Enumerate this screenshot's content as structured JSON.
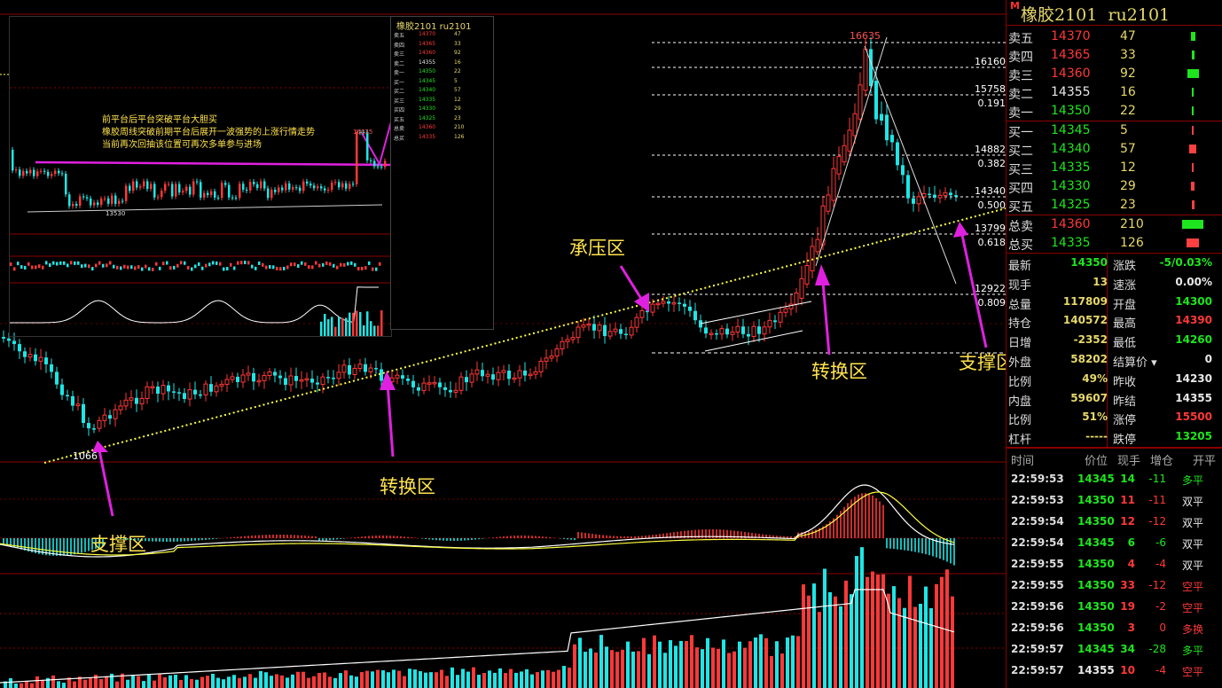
{
  "instrument": {
    "name": "橡胶2101",
    "code": "ru2101",
    "marker": "M"
  },
  "chart_annotations": {
    "support_left": "支撑区",
    "switch_mid": "转换区",
    "resist": "承压区",
    "switch_right": "转换区",
    "support_right": "支撑区",
    "low_label": "1066",
    "high_label": "16635",
    "note_lines": [
      "前平台后平台突破平台大胆买",
      "橡胶周线突破前期平台后展开一波强势的上涨行情走势",
      "当前再次回抽该位置可再次多单参与进场"
    ]
  },
  "fib_levels": [
    {
      "price": "16160",
      "ratio": ""
    },
    {
      "price": "15758",
      "ratio": "0.191"
    },
    {
      "price": "14882",
      "ratio": "0.382"
    },
    {
      "price": "14340",
      "ratio": "0.500"
    },
    {
      "price": "13799",
      "ratio": "0.618"
    },
    {
      "price": "12922",
      "ratio": "0.809"
    }
  ],
  "order_book": {
    "asks": [
      {
        "label": "卖五",
        "price": "14370",
        "vol": "47",
        "color": "#ff3838",
        "bar": 0.2
      },
      {
        "label": "卖四",
        "price": "14365",
        "vol": "33",
        "color": "#ff3838",
        "bar": 0.14
      },
      {
        "label": "卖三",
        "price": "14360",
        "vol": "92",
        "color": "#ff3838",
        "bar": 0.55
      },
      {
        "label": "卖二",
        "price": "14355",
        "vol": "16",
        "color": "#e8e8e8",
        "bar": 0.07
      },
      {
        "label": "卖一",
        "price": "14350",
        "vol": "22",
        "color": "#1ee61e",
        "bar": 0.09
      }
    ],
    "bids": [
      {
        "label": "买一",
        "price": "14345",
        "vol": "5",
        "color": "#1ee61e",
        "bar": 0.03
      },
      {
        "label": "买二",
        "price": "14340",
        "vol": "57",
        "color": "#1ee61e",
        "bar": 0.35
      },
      {
        "label": "买三",
        "price": "14335",
        "vol": "12",
        "color": "#1ee61e",
        "bar": 0.07
      },
      {
        "label": "买四",
        "price": "14330",
        "vol": "29",
        "color": "#1ee61e",
        "bar": 0.17
      },
      {
        "label": "买五",
        "price": "14325",
        "vol": "23",
        "color": "#1ee61e",
        "bar": 0.14
      }
    ],
    "total_ask": {
      "label": "总卖",
      "price": "14360",
      "vol": "210",
      "bar": 1.0
    },
    "total_bid": {
      "label": "总买",
      "price": "14335",
      "vol": "126",
      "bar": 0.6
    }
  },
  "quote": {
    "rows": [
      {
        "l1": "最新",
        "v1": "14350",
        "c1": "#1ee61e",
        "l2": "涨跌",
        "v2": "-5/0.03%",
        "c2": "#1ee61e"
      },
      {
        "l1": "现手",
        "v1": "13",
        "c1": "#e6d86a",
        "l2": "速涨",
        "v2": "0.00%",
        "c2": "#e8e8e8"
      },
      {
        "l1": "总量",
        "v1": "117809",
        "c1": "#e6d86a",
        "l2": "开盘",
        "v2": "14300",
        "c2": "#1ee61e"
      },
      {
        "l1": "持仓",
        "v1": "140572",
        "c1": "#e6d86a",
        "l2": "最高",
        "v2": "14390",
        "c2": "#ff3838"
      },
      {
        "l1": "日增",
        "v1": "-2352",
        "c1": "#e6d86a",
        "l2": "最低",
        "v2": "14260",
        "c2": "#1ee61e"
      },
      {
        "l1": "外盘",
        "v1": "58202",
        "c1": "#e6d86a",
        "l2": "结算价",
        "v2": "0",
        "c2": "#e8e8e8"
      },
      {
        "l1": "比例",
        "v1": "49%",
        "c1": "#e6d86a",
        "l2": "昨收",
        "v2": "14230",
        "c2": "#e8e8e8"
      },
      {
        "l1": "内盘",
        "v1": "59607",
        "c1": "#e6d86a",
        "l2": "昨结",
        "v2": "14355",
        "c2": "#e8e8e8"
      },
      {
        "l1": "比例",
        "v1": "51%",
        "c1": "#e6d86a",
        "l2": "涨停",
        "v2": "15500",
        "c2": "#ff3838"
      },
      {
        "l1": "杠杆",
        "v1": "-----",
        "c1": "#e6d86a",
        "l2": "跌停",
        "v2": "13205",
        "c2": "#1ee61e"
      }
    ]
  },
  "ticks": {
    "headers": [
      "时间",
      "价位",
      "现手",
      "增仓",
      "开平"
    ],
    "rows": [
      {
        "time": "22:59:53",
        "price": "14345",
        "pc": "#1ee61e",
        "vol": "14",
        "vc": "#1ee61e",
        "oi": "-11",
        "type": "多平",
        "tc": "#1ee61e"
      },
      {
        "time": "22:59:53",
        "price": "14350",
        "pc": "#1ee61e",
        "vol": "11",
        "vc": "#ff3838",
        "oi": "-11",
        "type": "双平",
        "tc": "#e8e8e8"
      },
      {
        "time": "22:59:54",
        "price": "14350",
        "pc": "#1ee61e",
        "vol": "12",
        "vc": "#ff3838",
        "oi": "-12",
        "type": "双平",
        "tc": "#e8e8e8"
      },
      {
        "time": "22:59:54",
        "price": "14345",
        "pc": "#1ee61e",
        "vol": "6",
        "vc": "#1ee61e",
        "oi": "-6",
        "type": "双平",
        "tc": "#e8e8e8"
      },
      {
        "time": "22:59:55",
        "price": "14350",
        "pc": "#1ee61e",
        "vol": "4",
        "vc": "#ff3838",
        "oi": "-4",
        "type": "双平",
        "tc": "#e8e8e8"
      },
      {
        "time": "22:59:55",
        "price": "14350",
        "pc": "#1ee61e",
        "vol": "33",
        "vc": "#ff3838",
        "oi": "-12",
        "type": "空平",
        "tc": "#ff3838"
      },
      {
        "time": "22:59:56",
        "price": "14350",
        "pc": "#1ee61e",
        "vol": "19",
        "vc": "#ff3838",
        "oi": "-2",
        "type": "空平",
        "tc": "#ff3838"
      },
      {
        "time": "22:59:56",
        "price": "14350",
        "pc": "#1ee61e",
        "vol": "3",
        "vc": "#ff3838",
        "oi": "0",
        "type": "多换",
        "tc": "#ff3838"
      },
      {
        "time": "22:59:57",
        "price": "14345",
        "pc": "#1ee61e",
        "vol": "34",
        "vc": "#1ee61e",
        "oi": "-28",
        "type": "多平",
        "tc": "#1ee61e"
      },
      {
        "time": "22:59:57",
        "price": "14355",
        "pc": "#e8e8e8",
        "vol": "10",
        "vc": "#ff3838",
        "oi": "-4",
        "type": "空平",
        "tc": "#ff3838"
      }
    ]
  },
  "mini_panel": {
    "title": "橡胶2101  ru2101",
    "low": "13530",
    "high": "16635"
  },
  "colors": {
    "up": "#ff3838",
    "down": "#1ee6e6",
    "support_line": "#ffff40",
    "arrow": "#e020e0",
    "grid": "#8b0000"
  }
}
